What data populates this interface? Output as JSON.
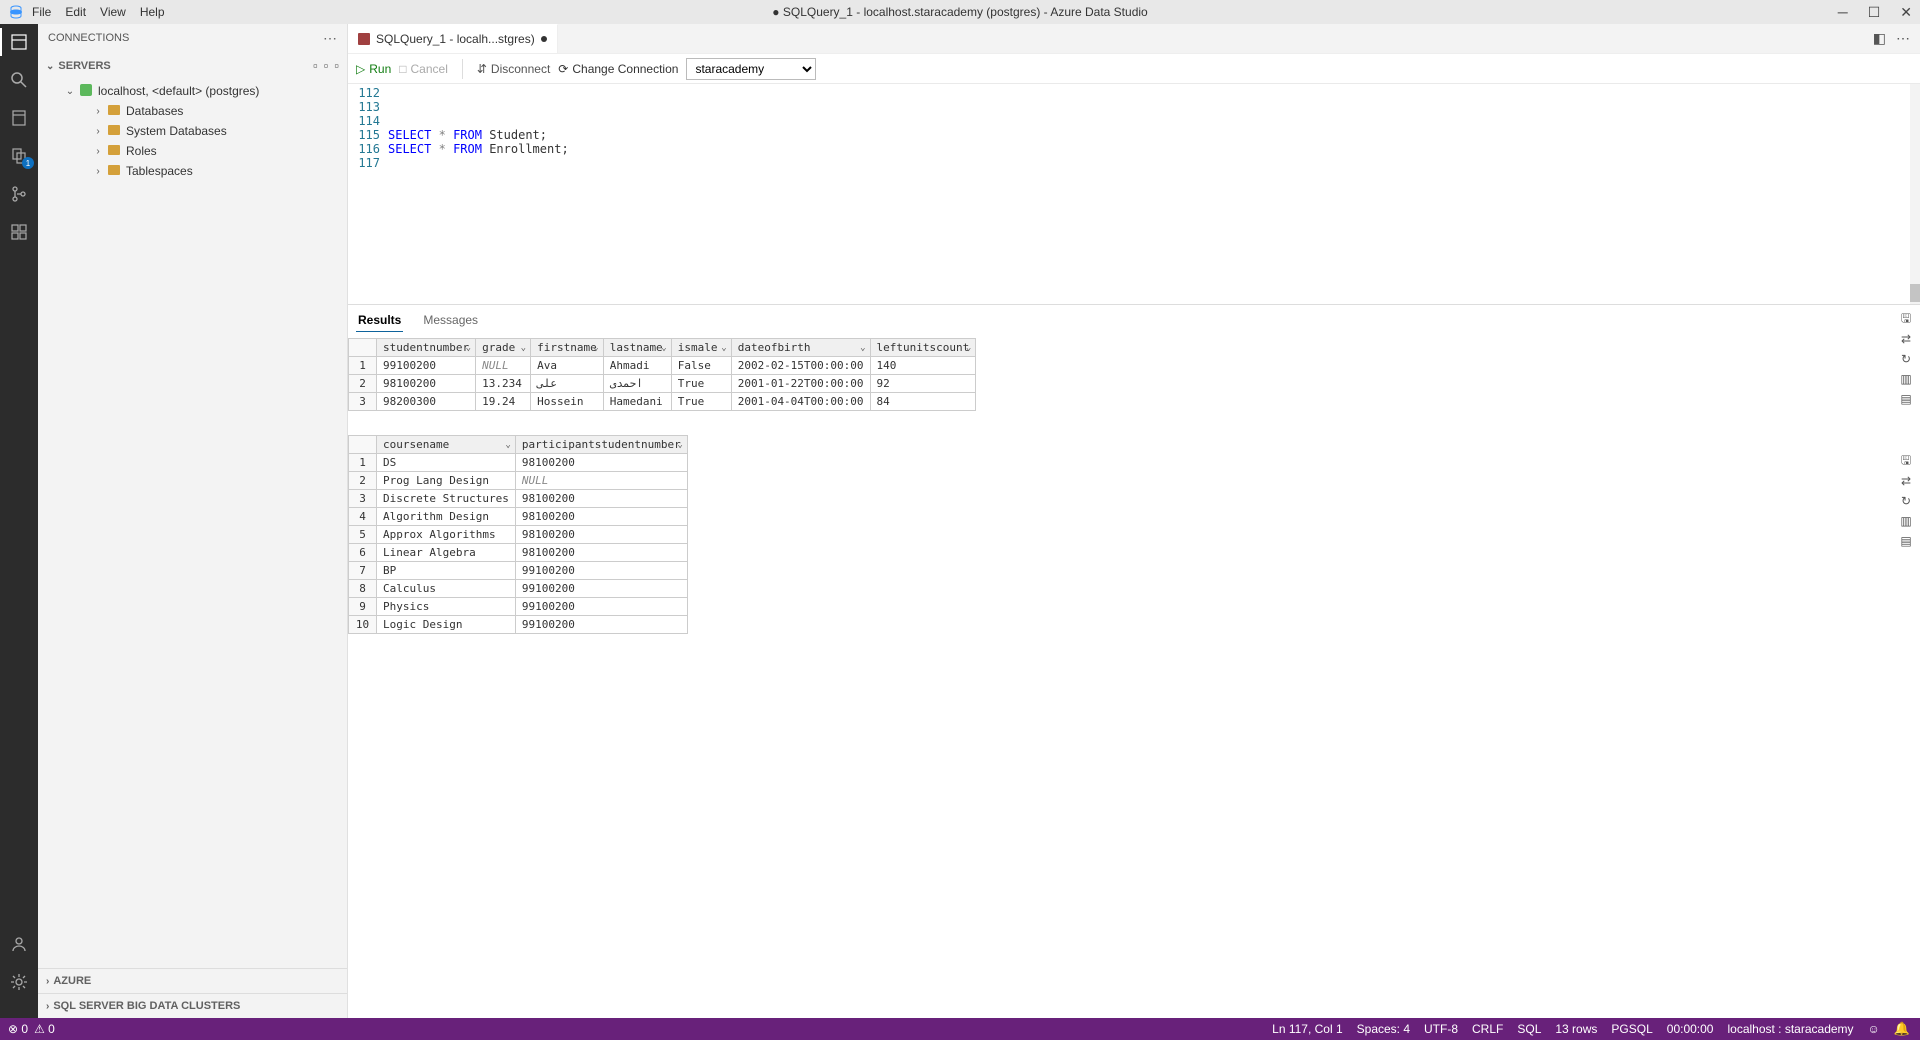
{
  "menubar": {
    "file": "File",
    "edit": "Edit",
    "view": "View",
    "help": "Help"
  },
  "window": {
    "title": "● SQLQuery_1 - localhost.staracademy (postgres) - Azure Data Studio"
  },
  "sidebar": {
    "header": "CONNECTIONS",
    "section_servers": "SERVERS",
    "server_label": "localhost, <default> (postgres)",
    "children": [
      "Databases",
      "System Databases",
      "Roles",
      "Tablespaces"
    ],
    "section_azure": "AZURE",
    "section_bigdata": "SQL SERVER BIG DATA CLUSTERS"
  },
  "tabs": {
    "active": "SQLQuery_1 - localh...stgres)"
  },
  "toolbar": {
    "run": "Run",
    "cancel": "Cancel",
    "disconnect": "Disconnect",
    "change": "Change Connection",
    "db": "staracademy"
  },
  "code": {
    "lines": [
      {
        "n": "112",
        "t": ""
      },
      {
        "n": "113",
        "t": ""
      },
      {
        "n": "114",
        "t": ""
      },
      {
        "n": "115",
        "k1": "SELECT",
        "op": "*",
        "k2": "FROM",
        "rest": " Student;"
      },
      {
        "n": "116",
        "k1": "SELECT",
        "op": "*",
        "k2": "FROM",
        "rest": " Enrollment;"
      },
      {
        "n": "117",
        "t": ""
      }
    ]
  },
  "results": {
    "tab_results": "Results",
    "tab_messages": "Messages",
    "grid1": {
      "columns": [
        "studentnumber",
        "grade",
        "firstname",
        "lastname",
        "ismale",
        "dateofbirth",
        "leftunitscount"
      ],
      "widths": [
        95,
        55,
        70,
        68,
        60,
        108,
        100
      ],
      "rows": [
        [
          "99100200",
          "NULL",
          "Ava",
          "Ahmadi",
          "False",
          "2002-02-15T00:00:00",
          "140"
        ],
        [
          "98100200",
          "13.234",
          "علی",
          "احمدی",
          "True",
          "2001-01-22T00:00:00",
          "92"
        ],
        [
          "98200300",
          "19.24",
          "Hossein",
          "Hamedani",
          "True",
          "2001-04-04T00:00:00",
          "84"
        ]
      ]
    },
    "grid2": {
      "columns": [
        "coursename",
        "participantstudentnumber"
      ],
      "widths": [
        110,
        150
      ],
      "rows": [
        [
          "DS",
          "98100200"
        ],
        [
          "Prog Lang Design",
          "NULL"
        ],
        [
          "Discrete Structures",
          "98100200"
        ],
        [
          "Algorithm Design",
          "98100200"
        ],
        [
          "Approx Algorithms",
          "98100200"
        ],
        [
          "Linear Algebra",
          "98100200"
        ],
        [
          "BP",
          "99100200"
        ],
        [
          "Calculus",
          "99100200"
        ],
        [
          "Physics",
          "99100200"
        ],
        [
          "Logic Design",
          "99100200"
        ]
      ]
    }
  },
  "status": {
    "errors": "0",
    "warnings": "0",
    "pos": "Ln 117, Col 1",
    "spaces": "Spaces: 4",
    "enc": "UTF-8",
    "eol": "CRLF",
    "lang": "SQL",
    "rows": "13 rows",
    "db": "PGSQL",
    "time": "00:00:00",
    "conn": "localhost : staracademy"
  }
}
